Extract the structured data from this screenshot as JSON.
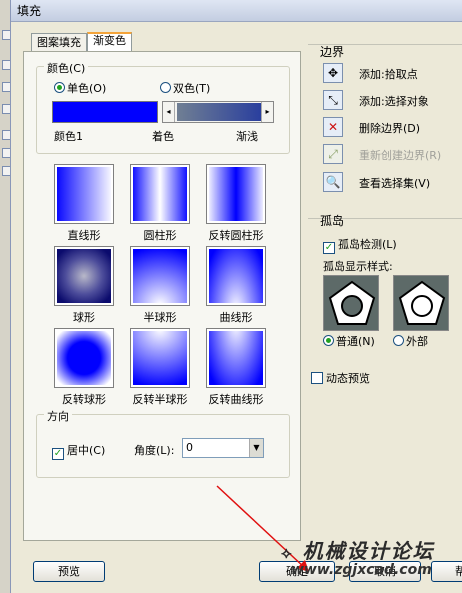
{
  "window": {
    "title": "填充"
  },
  "tabs": [
    {
      "label": "图案填充"
    },
    {
      "label": "渐变色"
    }
  ],
  "color": {
    "group_label": "颜色(C)",
    "single_label": "单色(O)",
    "double_label": "双色(T)",
    "swatch_label": "颜色1",
    "shade_label": "着色",
    "tint_label": "渐浅",
    "color1": "#0000ff",
    "accent": "#2a3f9e"
  },
  "gradients": [
    {
      "label": "直线形"
    },
    {
      "label": "圆柱形"
    },
    {
      "label": "反转圆柱形"
    },
    {
      "label": "球形"
    },
    {
      "label": "半球形"
    },
    {
      "label": "曲线形"
    },
    {
      "label": "反转球形"
    },
    {
      "label": "反转半球形"
    },
    {
      "label": "反转曲线形"
    }
  ],
  "orientation": {
    "group_label": "方向",
    "centered_label": "居中(C)",
    "angle_label": "角度(L):",
    "angle_value": "0"
  },
  "boundary": {
    "title": "边界",
    "items": [
      {
        "label": "添加:拾取点",
        "icon": "pick-point-icon",
        "enabled": true
      },
      {
        "label": "添加:选择对象",
        "icon": "select-objects-icon",
        "enabled": true
      },
      {
        "label": "删除边界(D)",
        "icon": "remove-boundary-icon",
        "enabled": true
      },
      {
        "label": "重新创建边界(R)",
        "icon": "recreate-boundary-icon",
        "enabled": false
      },
      {
        "label": "查看选择集(V)",
        "icon": "view-selection-icon",
        "enabled": true
      }
    ]
  },
  "island": {
    "title": "孤岛",
    "detect_label": "孤岛检测(L)",
    "style_label": "孤岛显示样式:",
    "normal_label": "普通(N)",
    "outer_label": "外部"
  },
  "preview_dynamic_label": "动态预览",
  "buttons": {
    "preview": "预览",
    "ok": "确定",
    "cancel": "取消",
    "help": "帮"
  },
  "watermark": {
    "text": "机械设计论坛",
    "url": "www.zgjxcad.com"
  }
}
